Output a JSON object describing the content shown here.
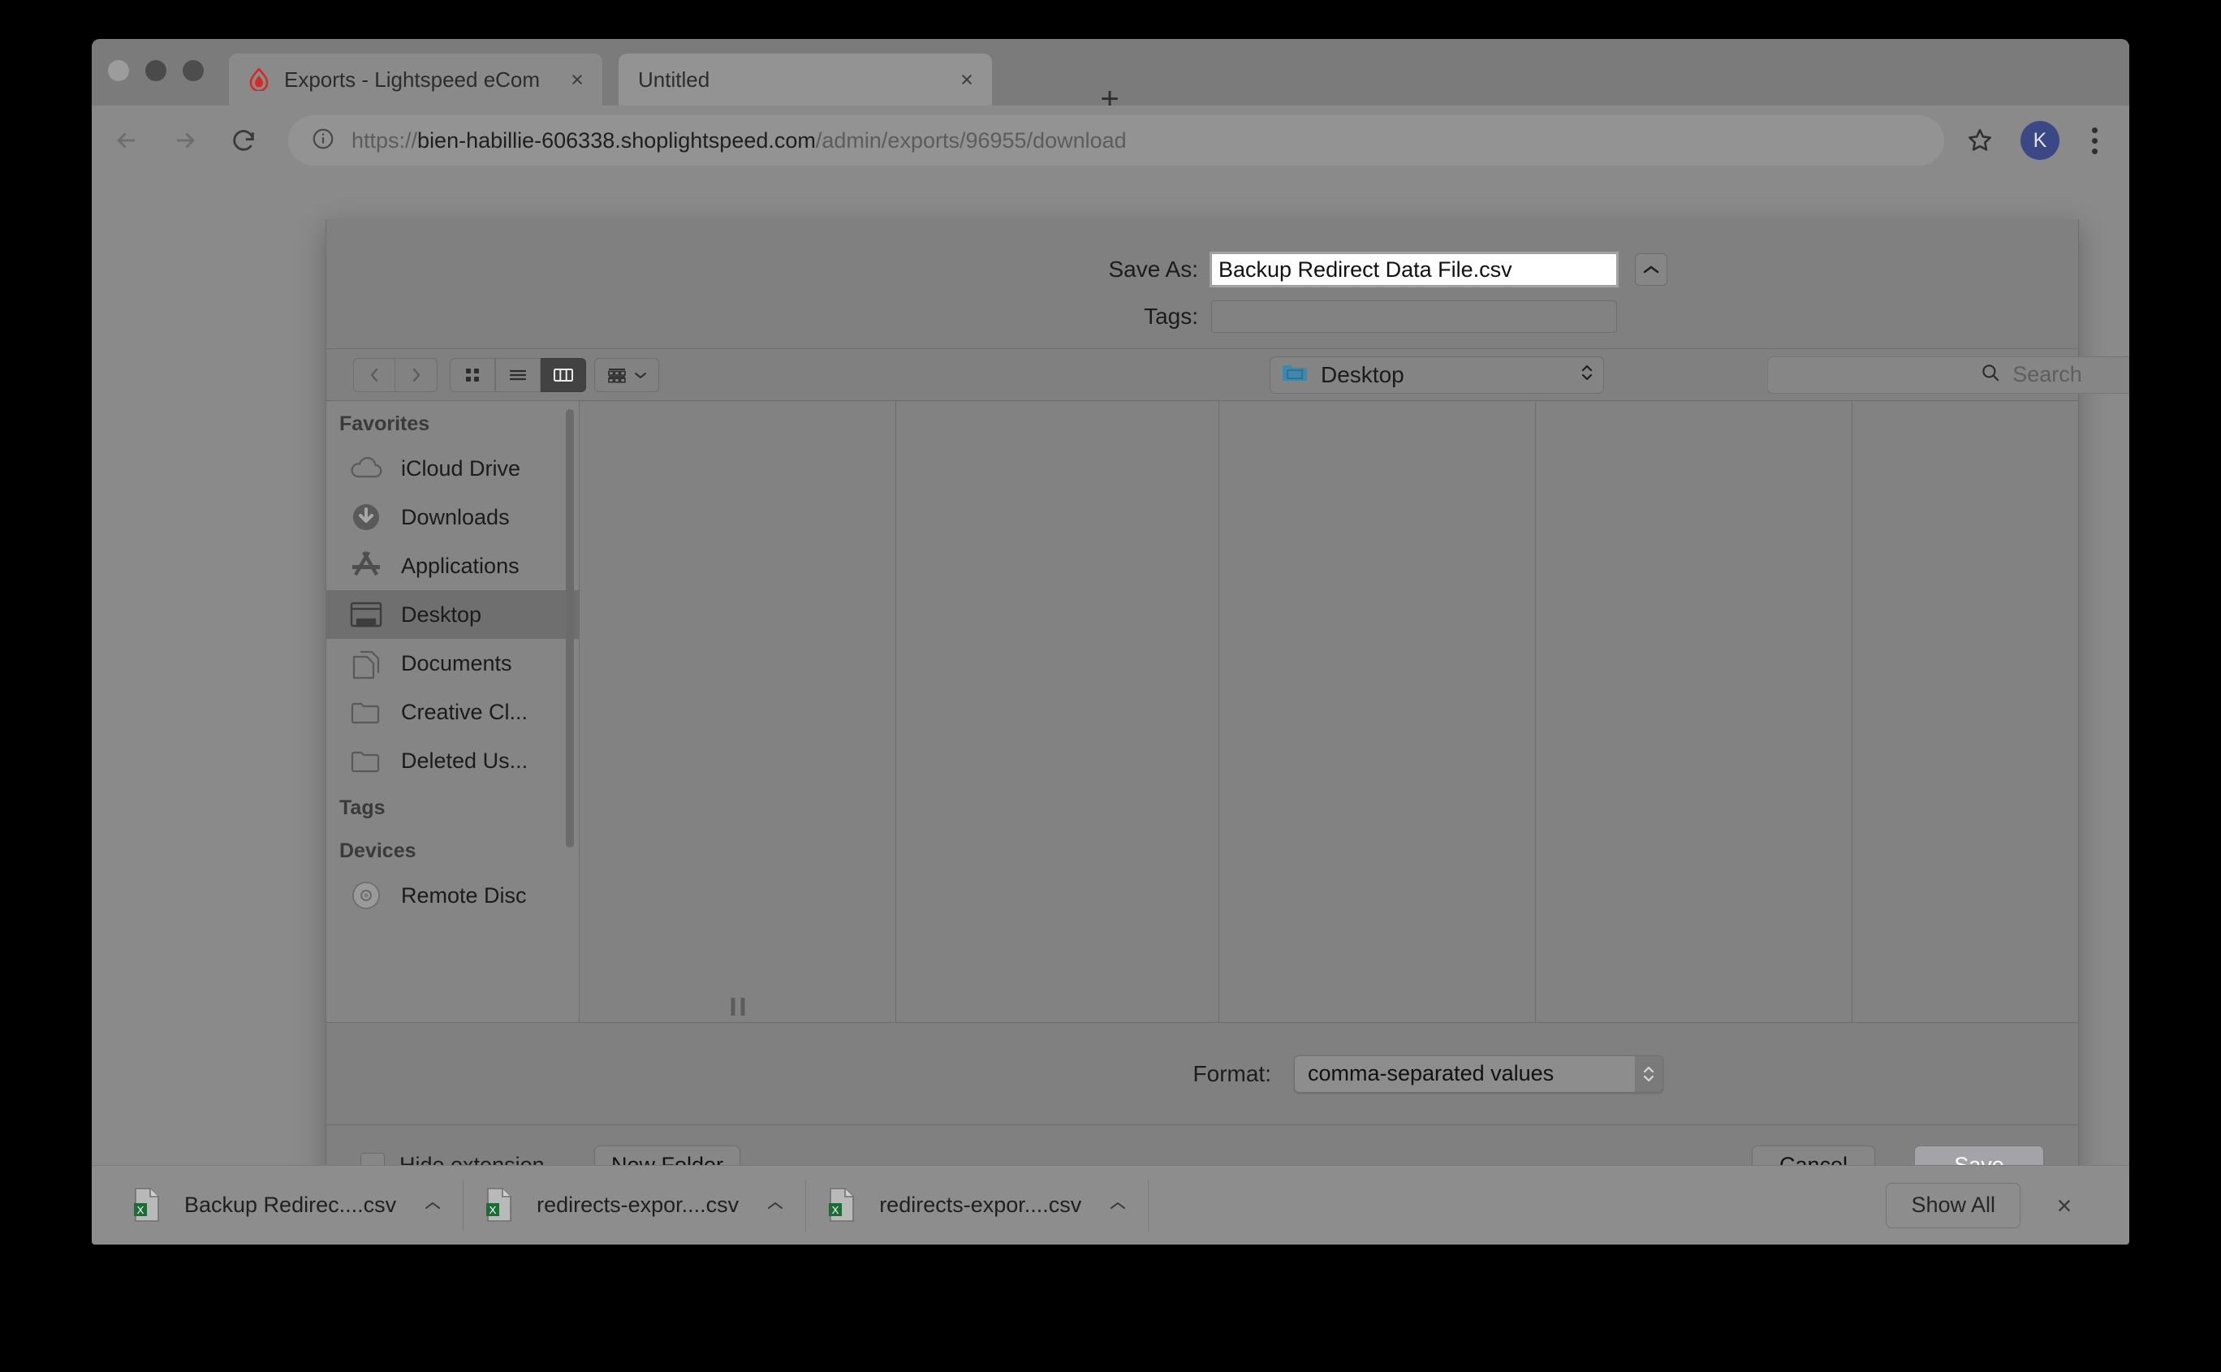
{
  "browser": {
    "tabs": [
      {
        "title": "Exports - Lightspeed eCom",
        "favicon": "lightspeed-flame-icon",
        "close_label": "×",
        "active": false
      },
      {
        "title": "Untitled",
        "favicon": "none",
        "close_label": "×",
        "active": true
      }
    ],
    "new_tab_label": "+",
    "toolbar": {
      "back_icon": "arrow-left-icon",
      "forward_icon": "arrow-right-icon",
      "reload_icon": "reload-icon",
      "site_info_icon": "info-circle-icon",
      "url_scheme": "https://",
      "url_host": "bien-habillie-606338.shoplightspeed.com",
      "url_path": "/admin/exports/96955/download",
      "url_full": "https://bien-habillie-606338.shoplightspeed.com/admin/exports/96955/download",
      "bookmark_icon": "star-icon",
      "profile_initial": "K",
      "menu_icon": "three-dots-vertical-icon"
    },
    "window_controls": {
      "close": "close",
      "minimize": "minimize",
      "maximize": "maximize"
    }
  },
  "save_dialog": {
    "save_as_label": "Save As:",
    "save_as_value": "Backup Redirect Data File.csv",
    "expand_icon": "chevron-up-icon",
    "tags_label": "Tags:",
    "tags_value": "",
    "toolbar": {
      "back_icon": "chevron-left-icon",
      "forward_icon": "chevron-right-icon",
      "view_icon_label": "icon-view",
      "view_list_label": "list-view",
      "view_column_label": "column-view",
      "arrange_label": "arrange-by",
      "arrange_caret": "chevron-down-icon"
    },
    "path_popup": {
      "label": "Desktop",
      "icon": "blue-folder-icon",
      "stepper_icon": "up-down-stepper-icon"
    },
    "search": {
      "placeholder": "Search",
      "icon": "search-icon"
    },
    "sidebar": {
      "sections": [
        {
          "header": "Favorites",
          "items": [
            {
              "label": "iCloud Drive",
              "icon": "icloud-drive-icon",
              "selected": false
            },
            {
              "label": "Downloads",
              "icon": "downloads-icon",
              "selected": false
            },
            {
              "label": "Applications",
              "icon": "applications-icon",
              "selected": false
            },
            {
              "label": "Desktop",
              "icon": "desktop-icon",
              "selected": true
            },
            {
              "label": "Documents",
              "icon": "documents-icon",
              "selected": false
            },
            {
              "label": "Creative Cl...",
              "icon": "folder-icon",
              "selected": false
            },
            {
              "label": "Deleted Us...",
              "icon": "folder-icon",
              "selected": false
            }
          ]
        },
        {
          "header": "Tags",
          "items": []
        },
        {
          "header": "Devices",
          "items": [
            {
              "label": "Remote Disc",
              "icon": "optical-disc-icon",
              "selected": false
            }
          ]
        }
      ]
    },
    "columns": [
      {
        "items": []
      },
      {
        "items": []
      },
      {
        "items": []
      },
      {
        "items": []
      },
      {
        "items": []
      }
    ],
    "format_label": "Format:",
    "format_value": "comma-separated values",
    "hide_extension_label": "Hide extension",
    "hide_extension_checked": false,
    "new_folder_label": "New Folder",
    "cancel_label": "Cancel",
    "save_label": "Save"
  },
  "download_bar": {
    "items": [
      {
        "name": "Backup Redirec....csv",
        "icon": "csv-file-icon",
        "caret": "chevron-up-icon"
      },
      {
        "name": "redirects-expor....csv",
        "icon": "csv-file-icon",
        "caret": "chevron-up-icon"
      },
      {
        "name": "redirects-expor....csv",
        "icon": "csv-file-icon",
        "caret": "chevron-up-icon"
      }
    ],
    "show_all_label": "Show All",
    "close_label": "×"
  },
  "colors": {
    "accent_blue": "#3c4785",
    "folder_blue": "#3f87ad",
    "csv_green": "#1d6b35",
    "flame_red": "#d32b28",
    "sheet_bg": "#808080"
  }
}
